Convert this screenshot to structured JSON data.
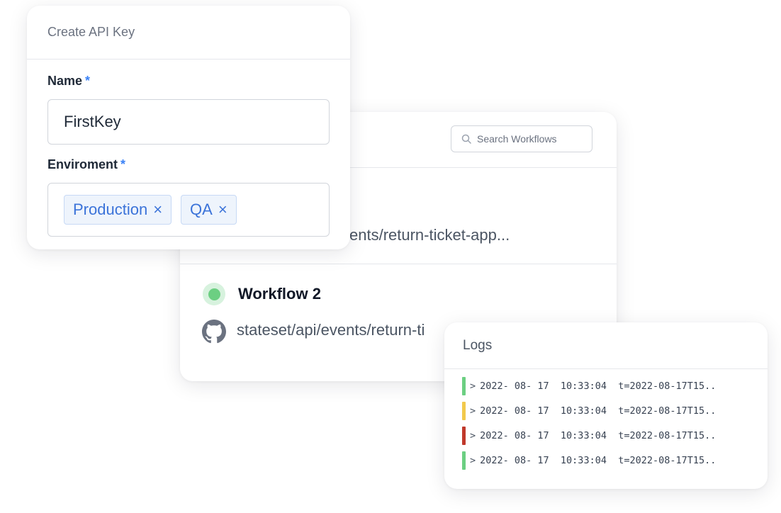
{
  "workflows": {
    "search_placeholder": "Search Workflows",
    "items": [
      {
        "path": "ents/return-ticket-app..."
      },
      {
        "title": "Workflow 2",
        "status_color": "#6ccf82",
        "path": "stateset/api/events/return-ti"
      }
    ]
  },
  "api_key_modal": {
    "title": "Create API Key",
    "name_label": "Name",
    "required_mark": "*",
    "name_value": "FirstKey",
    "environment_label": "Enviroment",
    "environments": [
      {
        "label": "Production",
        "remove": "×"
      },
      {
        "label": "QA",
        "remove": "×"
      }
    ]
  },
  "logs": {
    "title": "Logs",
    "chevron": ">",
    "rows": [
      {
        "level_color": "#6ccf82",
        "text": "2022- 08- 17  10:33:04  t=2022-08-17T15.."
      },
      {
        "level_color": "#f2c94c",
        "text": "2022- 08- 17  10:33:04  t=2022-08-17T15.."
      },
      {
        "level_color": "#c0392b",
        "text": "2022- 08- 17  10:33:04  t=2022-08-17T15.."
      },
      {
        "level_color": "#6ccf82",
        "text": "2022- 08- 17  10:33:04  t=2022-08-17T15.."
      }
    ]
  },
  "icons": {
    "search": "search-icon",
    "github": "github-icon",
    "remove": "close-icon"
  }
}
